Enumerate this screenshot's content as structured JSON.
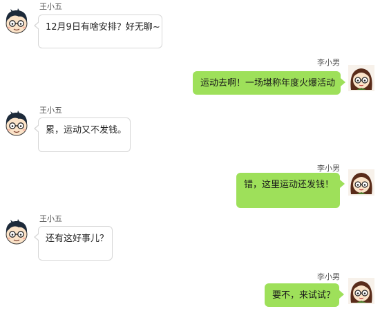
{
  "users": {
    "boy": {
      "name": "王小五",
      "avatar_icon": "boy-avatar-icon"
    },
    "girl": {
      "name": "李小男",
      "avatar_icon": "girl-avatar-icon"
    }
  },
  "colors": {
    "incoming_bubble": "#ffffff",
    "incoming_border": "#d6d6d6",
    "outgoing_bubble": "#9ee05a"
  },
  "messages": [
    {
      "sender": "王小五",
      "side": "left",
      "text": "12月9日有啥安排？好无聊~"
    },
    {
      "sender": "李小男",
      "side": "right",
      "text": "运动去啊！一场堪称年度火爆活动"
    },
    {
      "sender": "王小五",
      "side": "left",
      "text": "累，运动又不发钱。"
    },
    {
      "sender": "李小男",
      "side": "right",
      "text": "错，这里运动还发钱！"
    },
    {
      "sender": "王小五",
      "side": "left",
      "text": "还有这好事儿？"
    },
    {
      "sender": "李小男",
      "side": "right",
      "text": "要不，来试试？"
    }
  ]
}
